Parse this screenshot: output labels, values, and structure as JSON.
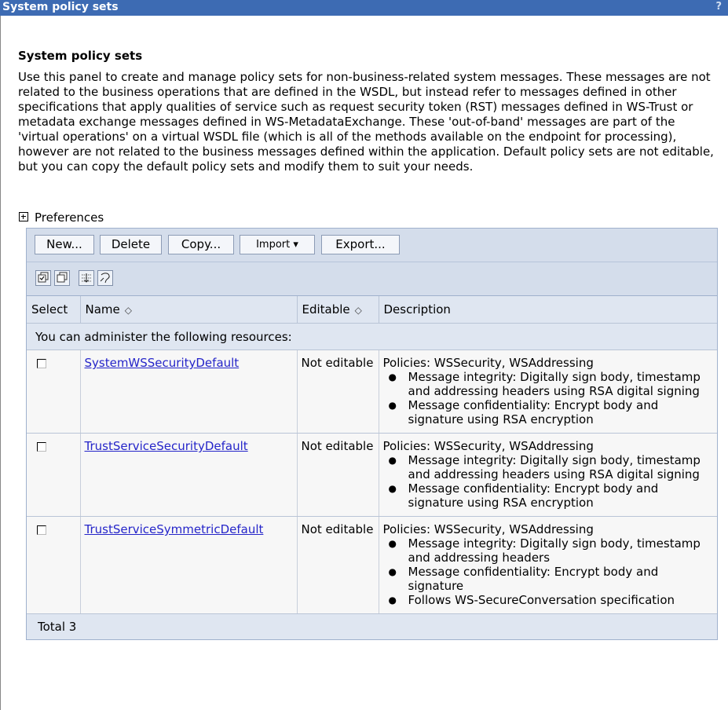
{
  "window": {
    "title": "System policy sets",
    "help": "?"
  },
  "page": {
    "heading": "System policy sets",
    "description": "Use this panel to create and manage policy sets for non-business-related system messages. These messages are not related to the business operations that are defined in the WSDL, but instead refer to messages defined in other specifications that apply qualities of service such as request security token (RST) messages defined in WS-Trust or metadata exchange messages defined in WS-MetadataExchange. These 'out-of-band' messages are part of the 'virtual operations' on a virtual WSDL file (which is all of the methods available on the endpoint for processing), however are not related to the business messages defined within the application. Default policy sets are not editable, but you can copy the default policy sets and modify them to suit your needs.",
    "preferences": "Preferences"
  },
  "toolbar": {
    "new": "New...",
    "delete": "Delete",
    "copy": "Copy...",
    "import": "Import ▾",
    "export": "Export..."
  },
  "table": {
    "headers": {
      "select": "Select",
      "name": "Name",
      "editable": "Editable",
      "description": "Description"
    },
    "sort_glyph": "◇",
    "resources_label": "You can administer the following resources:",
    "rows": [
      {
        "name": "SystemWSSecurityDefault",
        "editable": "Not editable",
        "policies": "Policies: WSSecurity, WSAddressing",
        "bullets": [
          "Message integrity: Digitally sign body, timestamp and addressing headers using RSA digital signing",
          "Message confidentiality: Encrypt body and signature using RSA encryption"
        ]
      },
      {
        "name": "TrustServiceSecurityDefault",
        "editable": "Not editable",
        "policies": "Policies: WSSecurity, WSAddressing",
        "bullets": [
          "Message integrity: Digitally sign body, timestamp and addressing headers using RSA digital signing",
          "Message confidentiality: Encrypt body and signature using RSA encryption"
        ]
      },
      {
        "name": "TrustServiceSymmetricDefault",
        "editable": "Not editable",
        "policies": "Policies: WSSecurity, WSAddressing",
        "bullets": [
          "Message integrity: Digitally sign body, timestamp and addressing headers",
          "Message confidentiality: Encrypt body and signature",
          "Follows WS-SecureConversation specification"
        ]
      }
    ],
    "total": "Total 3"
  }
}
